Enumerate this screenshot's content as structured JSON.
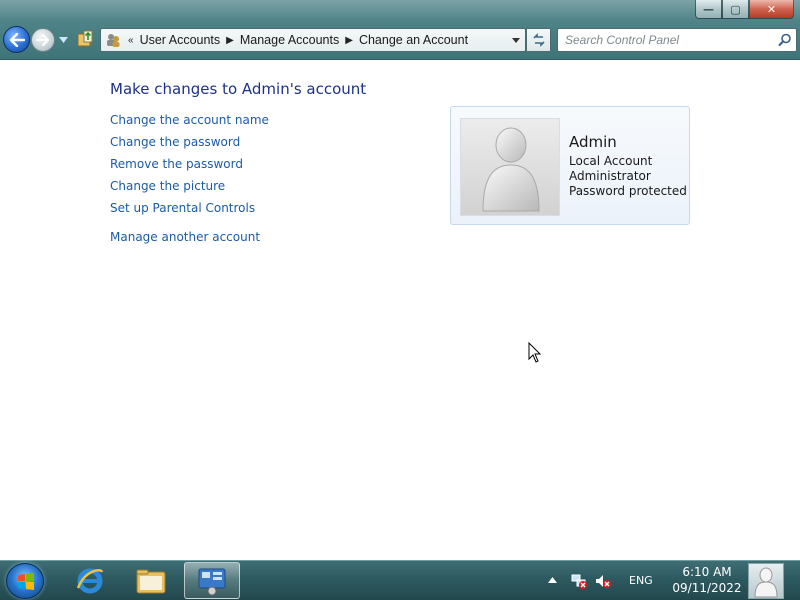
{
  "window": {
    "controls": {
      "minimize": "—",
      "maximize": "▢",
      "close": "✕"
    }
  },
  "navigation": {
    "breadcrumb_prefix": "«",
    "breadcrumb": [
      "User Accounts",
      "Manage Accounts",
      "Change an Account"
    ],
    "search_placeholder": "Search Control Panel"
  },
  "main": {
    "title": "Make changes to Admin's account",
    "tasks": [
      "Change the account name",
      "Change the password",
      "Remove the password",
      "Change the picture",
      "Set up Parental Controls"
    ],
    "secondary_task": "Manage another account"
  },
  "account": {
    "name": "Admin",
    "type": "Local Account",
    "role": "Administrator",
    "status": "Password protected"
  },
  "taskbar": {
    "pinned": [
      "start-orb",
      "internet-explorer-icon",
      "windows-explorer-icon",
      "control-panel-icon"
    ],
    "active_app": "control-panel",
    "language": "ENG",
    "time": "6:10 AM",
    "date": "09/11/2022"
  },
  "colors": {
    "link": "#1a5ba8",
    "title": "#1e3287",
    "chrome": "#4d8287",
    "taskbar": "#2d5a60"
  }
}
